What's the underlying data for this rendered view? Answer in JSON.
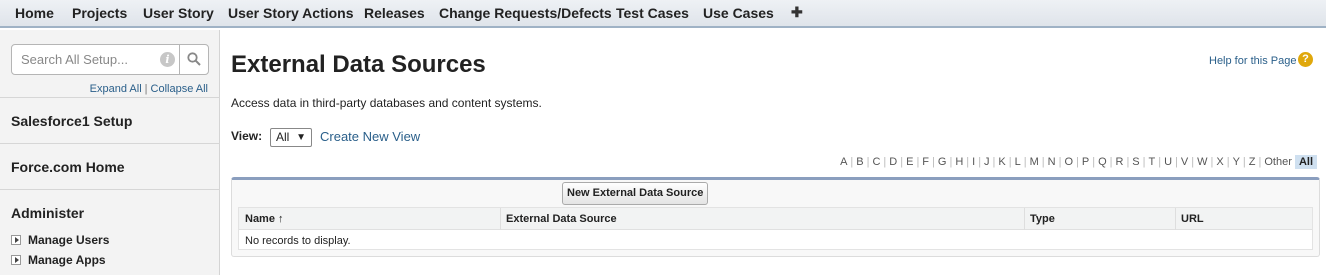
{
  "tabs": [
    "Home",
    "Projects",
    "User Story",
    "User Story Actions",
    "Releases",
    "Change Requests/Defects",
    "Test Cases",
    "Use Cases"
  ],
  "tab_add_symbol": "✚",
  "sidebar": {
    "search_placeholder": "Search All Setup...",
    "info_symbol": "i",
    "expand_all": "Expand All",
    "separator": "|",
    "collapse_all": "Collapse All",
    "sections": [
      "Salesforce1 Setup",
      "Force.com Home",
      "Administer"
    ],
    "items": [
      "Manage Users",
      "Manage Apps"
    ]
  },
  "page": {
    "title": "External Data Sources",
    "help_link": "Help for this Page",
    "help_symbol": "?",
    "description": "Access data in third-party databases and content systems.",
    "view_label": "View:",
    "view_value": "All",
    "view_arrow": "▼",
    "create_view": "Create New View"
  },
  "alphabet": [
    "A",
    "B",
    "C",
    "D",
    "E",
    "F",
    "G",
    "H",
    "I",
    "J",
    "K",
    "L",
    "M",
    "N",
    "O",
    "P",
    "Q",
    "R",
    "S",
    "T",
    "U",
    "V",
    "W",
    "X",
    "Y",
    "Z",
    "Other",
    "All"
  ],
  "table": {
    "new_button": "New External Data Source",
    "columns": [
      "Name ↑",
      "External Data Source",
      "Type",
      "URL"
    ],
    "empty_message": "No records to display."
  },
  "colors": {
    "accent": "#8a9ebe",
    "link": "#2a5f8a",
    "help": "#e0a80c"
  }
}
